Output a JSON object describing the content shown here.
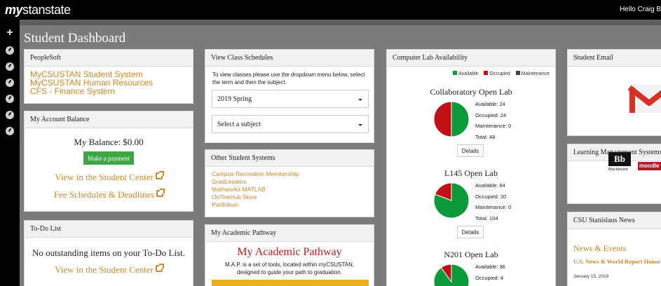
{
  "app": {
    "logo_my": "my",
    "logo_rest": "stanstate",
    "greeting": "Hello Craig B"
  },
  "page": {
    "title": "Student Dashboard"
  },
  "sidebar": {
    "icons": [
      "plus-icon",
      "dashboard-gauge-icon",
      "dashboard-gauge-icon",
      "dashboard-gauge-icon",
      "dashboard-gauge-icon",
      "dashboard-gauge-icon",
      "dashboard-gauge-icon"
    ]
  },
  "peoplesoft": {
    "title": "PeopleSoft",
    "links": [
      "MyCSUSTAN Student System",
      "MyCSUSTAN Human Resources",
      "CFS - Finance System"
    ]
  },
  "account": {
    "title": "My Account Balance",
    "balance": "My Balance: $0.00",
    "pay_label": "Make a payment",
    "student_center": "View in the Student Center",
    "fee_schedules": "Fee Schedules & Deadlines"
  },
  "todo": {
    "title": "To-Do List",
    "message": "No outstanding items on your To-Do List.",
    "student_center": "View in the Student Center"
  },
  "class_schedules": {
    "title": "View Class Schedules",
    "instructions": "To view classes please use the dropdown menu below, select the term and then the subject.",
    "term_selected": "2019 Spring",
    "subject_placeholder": "Select a subject"
  },
  "other_systems": {
    "title": "Other Student Systems",
    "links": [
      "Campus Recreation Membership",
      "GradLeaders",
      "Mathworks MATLAB",
      "OnTheHub Store",
      "Portfolium"
    ]
  },
  "pathway": {
    "title": "My Academic Pathway",
    "heading": "My Academic Pathway",
    "description": "M.A.P. is a set of tools, located within myCSUSTAN, designed to guide your path to graduation."
  },
  "labs": {
    "title": "Computer Lab Availability",
    "legend": [
      "Available",
      "Occupied",
      "Maintenance"
    ],
    "colors": {
      "available": "#0b9a3a",
      "occupied": "#c20f16",
      "maintenance": "#444444"
    },
    "details_label": "Details",
    "items": [
      {
        "name": "Collaboratory Open Lab",
        "available": "Available: 24",
        "occupied": "Occupied: 24",
        "maintenance": "Maintenance: 0",
        "total": "Total: 48",
        "avail_n": 24,
        "occ_n": 24,
        "maint_n": 0
      },
      {
        "name": "L145 Open Lab",
        "available": "Available: 84",
        "occupied": "Occupied: 20",
        "maintenance": "Maintenance: 0",
        "total": "Total: 104",
        "avail_n": 84,
        "occ_n": 20,
        "maint_n": 0
      },
      {
        "name": "N201 Open Lab",
        "available": "Available: 36",
        "occupied": "Occupied: 4",
        "avail_n": 36,
        "occ_n": 4,
        "maint_n": 0
      }
    ]
  },
  "email": {
    "title": "Student Email"
  },
  "lms": {
    "title": "Learning Management Systems",
    "blackboard_logo": "Bb",
    "blackboard_label": "Blackboard",
    "moodle_label": "moodle"
  },
  "news": {
    "title": "CSU Stanislaus News",
    "heading": "News & Events",
    "item_title": "U.S. News & World Report Honor MBA Program",
    "item_date": "January 15, 2019"
  }
}
